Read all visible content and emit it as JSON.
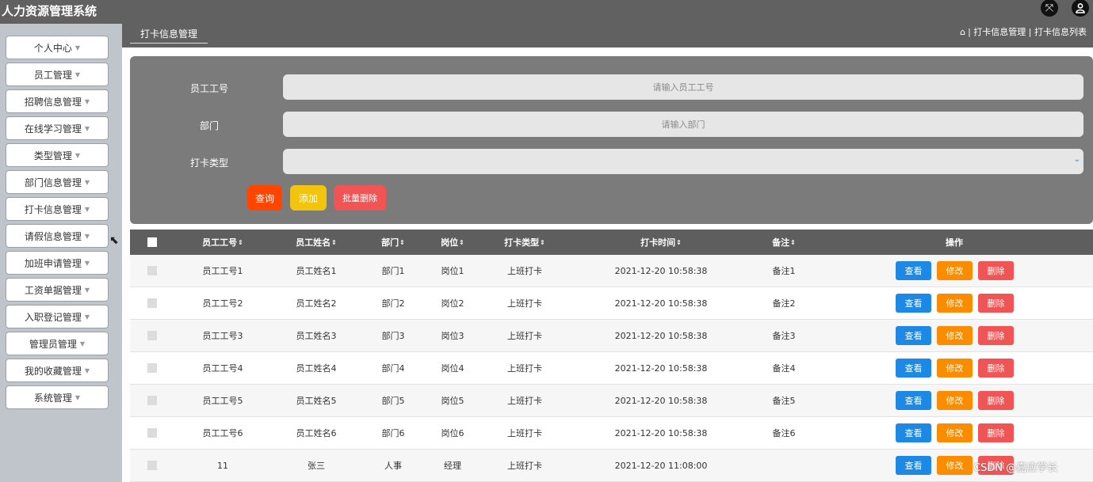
{
  "app": {
    "title": "人力资源管理系统"
  },
  "header": {
    "fullscreen_icon": "fullscreen-icon",
    "user_icon": "user-icon"
  },
  "sidebar": {
    "items": [
      {
        "label": "个人中心"
      },
      {
        "label": "员工管理"
      },
      {
        "label": "招聘信息管理"
      },
      {
        "label": "在线学习管理"
      },
      {
        "label": "类型管理"
      },
      {
        "label": "部门信息管理"
      },
      {
        "label": "打卡信息管理"
      },
      {
        "label": "请假信息管理"
      },
      {
        "label": "加班申请管理"
      },
      {
        "label": "工资单据管理"
      },
      {
        "label": "入职登记管理"
      },
      {
        "label": "管理员管理"
      },
      {
        "label": "我的收藏管理"
      },
      {
        "label": "系统管理"
      }
    ]
  },
  "breadcrumb": {
    "tab": "打卡信息管理",
    "path": "| 打卡信息管理 | 打卡信息列表"
  },
  "search": {
    "fields": [
      {
        "label": "员工工号",
        "placeholder": "请输入员工工号"
      },
      {
        "label": "部门",
        "placeholder": "请输入部门"
      },
      {
        "label": "打卡类型",
        "value": ""
      }
    ],
    "buttons": {
      "search": "查询",
      "add": "添加",
      "batch_delete": "批量删除"
    }
  },
  "table": {
    "headers": [
      "员工工号",
      "员工姓名",
      "部门",
      "岗位",
      "打卡类型",
      "打卡时间",
      "备注",
      "操作"
    ],
    "action_labels": {
      "view": "查看",
      "edit": "修改",
      "delete": "删除"
    },
    "rows": [
      [
        "员工工号1",
        "员工姓名1",
        "部门1",
        "岗位1",
        "上班打卡",
        "2021-12-20 10:58:38",
        "备注1"
      ],
      [
        "员工工号2",
        "员工姓名2",
        "部门2",
        "岗位2",
        "上班打卡",
        "2021-12-20 10:58:38",
        "备注2"
      ],
      [
        "员工工号3",
        "员工姓名3",
        "部门3",
        "岗位3",
        "上班打卡",
        "2021-12-20 10:58:38",
        "备注3"
      ],
      [
        "员工工号4",
        "员工姓名4",
        "部门4",
        "岗位4",
        "上班打卡",
        "2021-12-20 10:58:38",
        "备注4"
      ],
      [
        "员工工号5",
        "员工姓名5",
        "部门5",
        "岗位5",
        "上班打卡",
        "2021-12-20 10:58:38",
        "备注5"
      ],
      [
        "员工工号6",
        "员工姓名6",
        "部门6",
        "岗位6",
        "上班打卡",
        "2021-12-20 10:58:38",
        "备注6"
      ],
      [
        "11",
        "张三",
        "人事",
        "经理",
        "上班打卡",
        "2021-12-20 11:08:00",
        ""
      ]
    ]
  },
  "watermark": "CSDN @嘉应学长"
}
